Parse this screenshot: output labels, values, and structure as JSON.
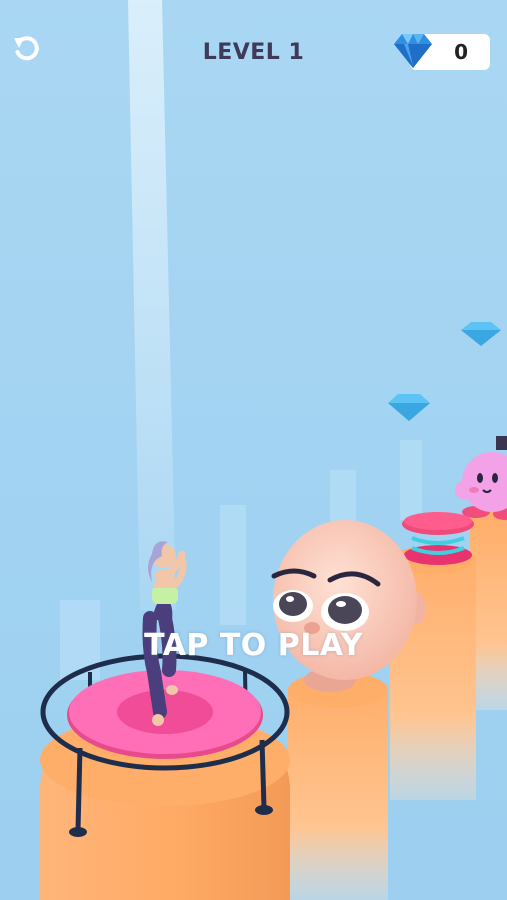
{
  "hud": {
    "level_label": "LEVEL 1",
    "gem_count": "0",
    "restart_icon": "restart-icon",
    "gem_icon": "diamond-icon"
  },
  "prompt": {
    "tap_to_play": "TAP TO PLAY"
  },
  "colors": {
    "sky": "#a8d5f2",
    "pillar": "#ffb070",
    "trampoline_pad": "#ff69b4",
    "gem": "#5bc0f0",
    "hud_text": "#3f3a57"
  }
}
